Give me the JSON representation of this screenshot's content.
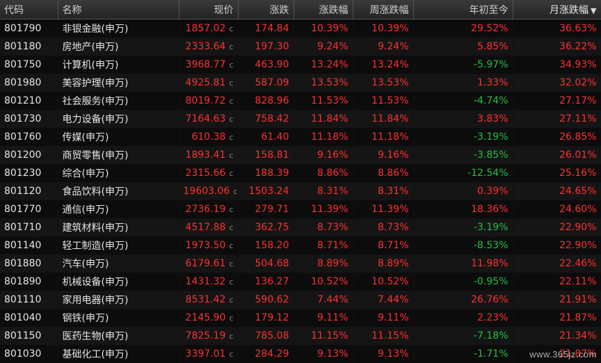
{
  "columns": {
    "code": "代码",
    "name": "名称",
    "price": "现价",
    "change": "涨跌",
    "pct": "涨跌幅",
    "week_pct": "周涨跌幅",
    "ytd": "年初至今",
    "month_pct": "月涨跌幅"
  },
  "sort": {
    "column": "month_pct",
    "direction": "desc",
    "icon": "sort-desc-icon"
  },
  "price_flag": "c",
  "colors": {
    "up": "#ff3030",
    "down": "#22c040"
  },
  "rows": [
    {
      "code": "801790",
      "name": "非银金融(申万)",
      "price": "1857.02",
      "change": "174.84",
      "pct": "10.39%",
      "week_pct": "10.39%",
      "ytd": "29.52%",
      "month_pct": "36.63%"
    },
    {
      "code": "801180",
      "name": "房地产(申万)",
      "price": "2333.64",
      "change": "197.30",
      "pct": "9.24%",
      "week_pct": "9.24%",
      "ytd": "5.85%",
      "month_pct": "36.22%"
    },
    {
      "code": "801750",
      "name": "计算机(申万)",
      "price": "3968.77",
      "change": "463.90",
      "pct": "13.24%",
      "week_pct": "13.24%",
      "ytd": "-5.97%",
      "month_pct": "34.93%"
    },
    {
      "code": "801980",
      "name": "美容护理(申万)",
      "price": "4925.81",
      "change": "587.09",
      "pct": "13.53%",
      "week_pct": "13.53%",
      "ytd": "1.33%",
      "month_pct": "32.02%"
    },
    {
      "code": "801210",
      "name": "社会服务(申万)",
      "price": "8019.72",
      "change": "828.96",
      "pct": "11.53%",
      "week_pct": "11.53%",
      "ytd": "-4.74%",
      "month_pct": "27.17%"
    },
    {
      "code": "801730",
      "name": "电力设备(申万)",
      "price": "7164.63",
      "change": "758.42",
      "pct": "11.84%",
      "week_pct": "11.84%",
      "ytd": "3.83%",
      "month_pct": "27.11%"
    },
    {
      "code": "801760",
      "name": "传媒(申万)",
      "price": "610.38",
      "change": "61.40",
      "pct": "11.18%",
      "week_pct": "11.18%",
      "ytd": "-3.19%",
      "month_pct": "26.85%"
    },
    {
      "code": "801200",
      "name": "商贸零售(申万)",
      "price": "1893.41",
      "change": "158.81",
      "pct": "9.16%",
      "week_pct": "9.16%",
      "ytd": "-3.85%",
      "month_pct": "26.01%"
    },
    {
      "code": "801230",
      "name": "综合(申万)",
      "price": "2315.66",
      "change": "188.39",
      "pct": "8.86%",
      "week_pct": "8.86%",
      "ytd": "-12.54%",
      "month_pct": "25.16%"
    },
    {
      "code": "801120",
      "name": "食品饮料(申万)",
      "price": "19603.06",
      "change": "1503.24",
      "pct": "8.31%",
      "week_pct": "8.31%",
      "ytd": "0.39%",
      "month_pct": "24.65%"
    },
    {
      "code": "801770",
      "name": "通信(申万)",
      "price": "2736.19",
      "change": "279.71",
      "pct": "11.39%",
      "week_pct": "11.39%",
      "ytd": "18.36%",
      "month_pct": "24.60%"
    },
    {
      "code": "801710",
      "name": "建筑材料(申万)",
      "price": "4517.88",
      "change": "362.75",
      "pct": "8.73%",
      "week_pct": "8.73%",
      "ytd": "-3.19%",
      "month_pct": "22.90%"
    },
    {
      "code": "801140",
      "name": "轻工制造(申万)",
      "price": "1973.50",
      "change": "158.20",
      "pct": "8.71%",
      "week_pct": "8.71%",
      "ytd": "-8.53%",
      "month_pct": "22.90%"
    },
    {
      "code": "801880",
      "name": "汽车(申万)",
      "price": "6179.61",
      "change": "504.68",
      "pct": "8.89%",
      "week_pct": "8.89%",
      "ytd": "11.98%",
      "month_pct": "22.46%"
    },
    {
      "code": "801890",
      "name": "机械设备(申万)",
      "price": "1431.32",
      "change": "136.27",
      "pct": "10.52%",
      "week_pct": "10.52%",
      "ytd": "-0.95%",
      "month_pct": "22.11%"
    },
    {
      "code": "801110",
      "name": "家用电器(申万)",
      "price": "8531.42",
      "change": "590.62",
      "pct": "7.44%",
      "week_pct": "7.44%",
      "ytd": "26.76%",
      "month_pct": "21.91%"
    },
    {
      "code": "801040",
      "name": "钢铁(申万)",
      "price": "2145.90",
      "change": "179.12",
      "pct": "9.11%",
      "week_pct": "9.11%",
      "ytd": "2.23%",
      "month_pct": "21.87%"
    },
    {
      "code": "801150",
      "name": "医药生物(申万)",
      "price": "7825.19",
      "change": "785.08",
      "pct": "11.15%",
      "week_pct": "11.15%",
      "ytd": "-7.18%",
      "month_pct": "21.34%"
    },
    {
      "code": "801030",
      "name": "基础化工(申万)",
      "price": "3397.01",
      "change": "284.29",
      "pct": "9.13%",
      "week_pct": "9.13%",
      "ytd": "-1.71%",
      "month_pct": "21.87%"
    }
  ],
  "watermark": "www.365jz.com"
}
